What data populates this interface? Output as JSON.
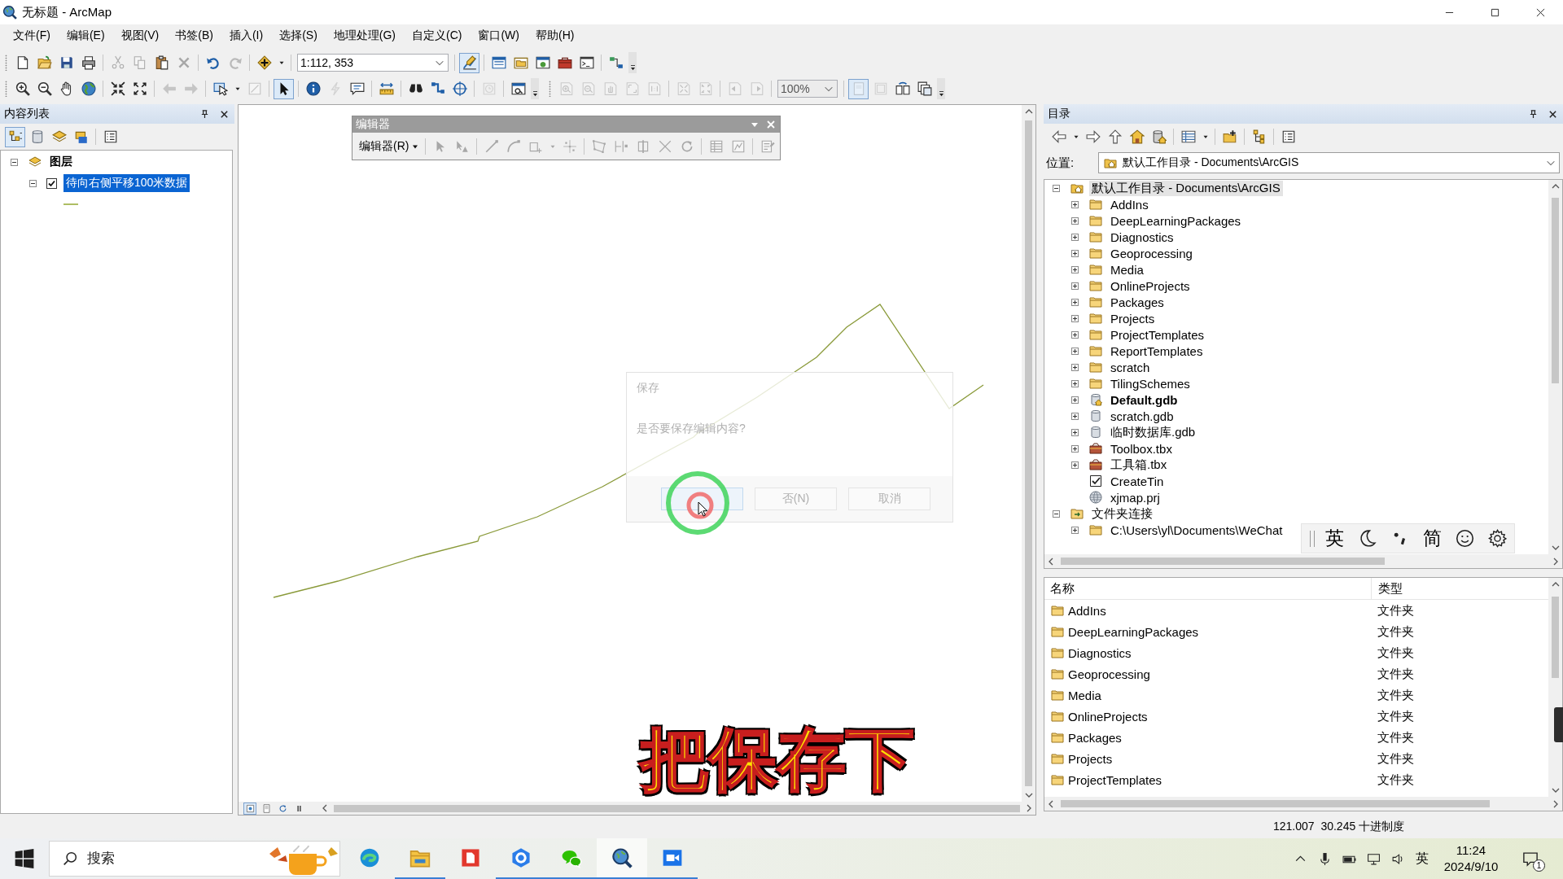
{
  "window": {
    "title": "无标题 - ArcMap"
  },
  "menu": [
    "文件(F)",
    "编辑(E)",
    "视图(V)",
    "书签(B)",
    "插入(I)",
    "选择(S)",
    "地理处理(G)",
    "自定义(C)",
    "窗口(W)",
    "帮助(H)"
  ],
  "toolbar_rows": [
    {
      "toolbars": [
        {
          "groups": [
            [
              {
                "kind": "new",
                "disabled": false,
                "pressed": false
              },
              {
                "kind": "open",
                "disabled": false,
                "pressed": false
              },
              {
                "kind": "save",
                "disabled": false,
                "pressed": false
              },
              {
                "kind": "print",
                "disabled": false,
                "pressed": false
              }
            ],
            [
              {
                "kind": "cut",
                "disabled": true,
                "pressed": false
              },
              {
                "kind": "copy",
                "disabled": true,
                "pressed": false
              },
              {
                "kind": "paste",
                "disabled": false,
                "pressed": false
              },
              {
                "kind": "delete",
                "disabled": true,
                "pressed": false
              }
            ],
            [
              {
                "kind": "undo",
                "disabled": false,
                "pressed": false
              },
              {
                "kind": "redo",
                "disabled": true,
                "pressed": false
              }
            ],
            [
              {
                "kind": "add-data",
                "disabled": false,
                "pressed": false
              },
              {
                "kind": "caret",
                "disabled": false,
                "pressed": false
              }
            ],
            [
              {
                "kind": "scale-combo",
                "value": "1:112, 353",
                "disabled": false,
                "pressed": false
              }
            ],
            [
              {
                "kind": "editor-toolbar",
                "disabled": false,
                "pressed": true
              }
            ],
            [
              {
                "kind": "toc-window",
                "disabled": false,
                "pressed": false
              },
              {
                "kind": "catalog-window",
                "disabled": false,
                "pressed": false
              },
              {
                "kind": "search-window",
                "disabled": false,
                "pressed": false
              },
              {
                "kind": "arctoolbox",
                "disabled": false,
                "pressed": false
              },
              {
                "kind": "python",
                "disabled": false,
                "pressed": false
              }
            ],
            [
              {
                "kind": "model-builder",
                "disabled": false,
                "pressed": false
              }
            ]
          ]
        }
      ]
    },
    {
      "toolbars": [
        {
          "groups": [
            [
              {
                "kind": "zoom-in",
                "disabled": false,
                "pressed": false
              },
              {
                "kind": "zoom-out",
                "disabled": false,
                "pressed": false
              },
              {
                "kind": "pan",
                "disabled": false,
                "pressed": false
              },
              {
                "kind": "full-extent",
                "disabled": false,
                "pressed": false
              }
            ],
            [
              {
                "kind": "fixed-zoom-in",
                "disabled": false,
                "pressed": false
              },
              {
                "kind": "fixed-zoom-out",
                "disabled": false,
                "pressed": false
              }
            ],
            [
              {
                "kind": "back",
                "disabled": true,
                "pressed": false
              },
              {
                "kind": "forward",
                "disabled": true,
                "pressed": false
              }
            ],
            [
              {
                "kind": "select-features",
                "disabled": false,
                "pressed": false
              },
              {
                "kind": "caret",
                "disabled": false,
                "pressed": false
              },
              {
                "kind": "clear-selection",
                "disabled": true,
                "pressed": false
              }
            ],
            [
              {
                "kind": "select-elements",
                "disabled": false,
                "pressed": true
              }
            ],
            [
              {
                "kind": "identify",
                "disabled": false,
                "pressed": false
              },
              {
                "kind": "hyperlink",
                "disabled": true,
                "pressed": false
              },
              {
                "kind": "html-popup",
                "disabled": false,
                "pressed": false
              }
            ],
            [
              {
                "kind": "measure",
                "disabled": false,
                "pressed": false
              }
            ],
            [
              {
                "kind": "find",
                "disabled": false,
                "pressed": false
              },
              {
                "kind": "find-route",
                "disabled": false,
                "pressed": false
              },
              {
                "kind": "go-to-xy",
                "disabled": false,
                "pressed": false
              }
            ],
            [
              {
                "kind": "time-slider",
                "disabled": true,
                "pressed": false
              }
            ],
            [
              {
                "kind": "viewer-window",
                "disabled": false,
                "pressed": false
              }
            ]
          ]
        },
        {
          "groups": [
            [
              {
                "kind": "page-zoom-in",
                "disabled": true,
                "pressed": false
              },
              {
                "kind": "page-zoom-out",
                "disabled": true,
                "pressed": false
              },
              {
                "kind": "page-pan",
                "disabled": true,
                "pressed": false
              },
              {
                "kind": "page-full",
                "disabled": true,
                "pressed": false
              },
              {
                "kind": "page-actual",
                "disabled": true,
                "pressed": false
              }
            ],
            [
              {
                "kind": "page-fixed-in",
                "disabled": true,
                "pressed": false
              },
              {
                "kind": "page-fixed-out",
                "disabled": true,
                "pressed": false
              }
            ],
            [
              {
                "kind": "page-back",
                "disabled": true,
                "pressed": false
              },
              {
                "kind": "page-forward",
                "disabled": true,
                "pressed": false
              }
            ],
            [
              {
                "kind": "zoom-combo",
                "value": "100%",
                "disabled": true,
                "pressed": false
              }
            ],
            [
              {
                "kind": "toggle-draft",
                "disabled": true,
                "pressed": true
              },
              {
                "kind": "focus-frame",
                "disabled": true,
                "pressed": false
              },
              {
                "kind": "change-layout",
                "disabled": false,
                "pressed": false
              },
              {
                "kind": "driven-pages",
                "disabled": false,
                "pressed": false
              }
            ]
          ]
        }
      ]
    }
  ],
  "table_of_contents": {
    "title": "内容列表",
    "toolbar": {
      "groups": [
        [
          {
            "kind": "list-drawing-order",
            "disabled": false,
            "pressed": true
          },
          {
            "kind": "list-source",
            "disabled": false,
            "pressed": false
          },
          {
            "kind": "list-visibility",
            "disabled": false,
            "pressed": false
          },
          {
            "kind": "list-selection",
            "disabled": false,
            "pressed": false
          }
        ],
        [
          {
            "kind": "options",
            "disabled": false,
            "pressed": false
          }
        ]
      ]
    },
    "tree": [
      {
        "label": "图层",
        "kind": "data-frame",
        "expanded": true,
        "selected": false,
        "children": [
          {
            "label": "待向右侧平移100米数据",
            "kind": "layer",
            "expanded": true,
            "checked": true,
            "selected": true
          }
        ]
      }
    ]
  },
  "map": {
    "editor_toolbar": {
      "title": "编辑器",
      "menu_label": "编辑器(R)",
      "groups": [
        [
          {
            "kind": "edit-tool",
            "disabled": true,
            "pressed": false
          },
          {
            "kind": "annotation-tool",
            "disabled": true,
            "pressed": false
          }
        ],
        [
          {
            "kind": "straight-segment",
            "disabled": true,
            "pressed": false
          },
          {
            "kind": "end-arc",
            "disabled": true,
            "pressed": false
          },
          {
            "kind": "trace",
            "disabled": true,
            "pressed": false
          },
          {
            "kind": "caret",
            "disabled": true,
            "pressed": false
          },
          {
            "kind": "midpoint",
            "disabled": true,
            "pressed": false
          }
        ],
        [
          {
            "kind": "edit-vertices",
            "disabled": true,
            "pressed": false
          },
          {
            "kind": "reshape",
            "disabled": true,
            "pressed": false
          },
          {
            "kind": "cut-polygons",
            "disabled": true,
            "pressed": false
          },
          {
            "kind": "split",
            "disabled": true,
            "pressed": false
          },
          {
            "kind": "rotate",
            "disabled": true,
            "pressed": false
          }
        ],
        [
          {
            "kind": "attributes",
            "disabled": true,
            "pressed": false
          },
          {
            "kind": "sketch-properties",
            "disabled": true,
            "pressed": false
          }
        ],
        [
          {
            "kind": "create-features",
            "disabled": true,
            "pressed": false
          }
        ]
      ]
    },
    "dialog": {
      "title": "保存",
      "message": "是否要保存编辑内容?",
      "buttons": [
        {
          "focused": true
        },
        {
          "label": "否(N)",
          "focused": false
        },
        {
          "label": "取消",
          "focused": false
        }
      ]
    },
    "view_buttons": [
      {
        "kind": "data-view",
        "pressed": true
      },
      {
        "kind": "layout-view",
        "pressed": false
      },
      {
        "kind": "refresh",
        "pressed": false
      },
      {
        "kind": "pause",
        "pressed": false
      }
    ]
  },
  "catalog": {
    "title": "目录",
    "toolbar": {
      "groups": [
        [
          {
            "kind": "back-nav",
            "disabled": false,
            "pressed": false
          },
          {
            "kind": "caret",
            "disabled": false,
            "pressed": false
          },
          {
            "kind": "forward-nav",
            "disabled": false,
            "pressed": false
          },
          {
            "kind": "up-level",
            "disabled": false,
            "pressed": false
          },
          {
            "kind": "home",
            "disabled": false,
            "pressed": false
          },
          {
            "kind": "home-database",
            "disabled": false,
            "pressed": false
          }
        ],
        [
          {
            "kind": "view-grid",
            "disabled": false,
            "pressed": false
          },
          {
            "kind": "caret",
            "disabled": false,
            "pressed": false
          }
        ],
        [
          {
            "kind": "connect-folder",
            "disabled": false,
            "pressed": false
          }
        ],
        [
          {
            "kind": "toggle-tree",
            "disabled": false,
            "pressed": false
          }
        ],
        [
          {
            "kind": "options",
            "disabled": false,
            "pressed": false
          }
        ]
      ]
    },
    "location_label": "位置:",
    "location": "默认工作目录 - Documents\\ArcGIS",
    "tree": [
      {
        "label": "默认工作目录 - Documents\\ArcGIS",
        "kind": "home-folder",
        "expanded": true,
        "selected": true,
        "children": [
          {
            "label": "AddIns",
            "kind": "folder",
            "expanded": false,
            "selected": false
          },
          {
            "label": "DeepLearningPackages",
            "kind": "folder",
            "expanded": false,
            "selected": false
          },
          {
            "label": "Diagnostics",
            "kind": "folder",
            "expanded": false,
            "selected": false
          },
          {
            "label": "Geoprocessing",
            "kind": "folder",
            "expanded": false,
            "selected": false
          },
          {
            "label": "Media",
            "kind": "folder",
            "expanded": false,
            "selected": false
          },
          {
            "label": "OnlineProjects",
            "kind": "folder",
            "expanded": false,
            "selected": false
          },
          {
            "label": "Packages",
            "kind": "folder",
            "expanded": false,
            "selected": false
          },
          {
            "label": "Projects",
            "kind": "folder",
            "expanded": false,
            "selected": false
          },
          {
            "label": "ProjectTemplates",
            "kind": "folder",
            "expanded": false,
            "selected": false
          },
          {
            "label": "ReportTemplates",
            "kind": "folder",
            "expanded": false,
            "selected": false
          },
          {
            "label": "scratch",
            "kind": "folder",
            "expanded": false,
            "selected": false
          },
          {
            "label": "TilingSchemes",
            "kind": "folder",
            "expanded": false,
            "selected": false
          },
          {
            "label": "Default.gdb",
            "kind": "default-gdb",
            "expanded": false,
            "selected": false
          },
          {
            "label": "scratch.gdb",
            "kind": "gdb",
            "expanded": false,
            "selected": false
          },
          {
            "label": "临时数据库.gdb",
            "kind": "gdb",
            "expanded": false,
            "selected": false
          },
          {
            "label": "Toolbox.tbx",
            "kind": "toolbox",
            "expanded": false,
            "selected": false
          },
          {
            "label": "工具箱.tbx",
            "kind": "toolbox",
            "expanded": false,
            "selected": false
          },
          {
            "label": "CreateTin",
            "kind": "tool",
            "selected": false
          },
          {
            "label": "xjmap.prj",
            "kind": "projection",
            "selected": false
          }
        ]
      },
      {
        "label": "文件夹连接",
        "kind": "folder-connection",
        "expanded": true,
        "selected": false,
        "children": [
          {
            "label": "C:\\Users\\yl\\Documents\\WeChat",
            "kind": "folder",
            "expanded": false,
            "selected": false
          }
        ]
      }
    ],
    "columns": [
      "名称",
      "类型"
    ],
    "rows": [
      {
        "name": "AddIns",
        "type": "文件夹"
      },
      {
        "name": "DeepLearningPackages",
        "type": "文件夹"
      },
      {
        "name": "Diagnostics",
        "type": "文件夹"
      },
      {
        "name": "Geoprocessing",
        "type": "文件夹"
      },
      {
        "name": "Media",
        "type": "文件夹"
      },
      {
        "name": "OnlineProjects",
        "type": "文件夹"
      },
      {
        "name": "Packages",
        "type": "文件夹"
      },
      {
        "name": "Projects",
        "type": "文件夹"
      },
      {
        "name": "ProjectTemplates",
        "type": "文件夹"
      }
    ]
  },
  "ime_toolbar": {
    "language": "英",
    "script": "简"
  },
  "subtitle": "把保存下",
  "status_bar": {
    "coordinates": "121.007  30.245 十进制度"
  },
  "taskbar": {
    "search_placeholder": "搜索",
    "apps": [
      {
        "kind": "edge",
        "running": false,
        "selected": false
      },
      {
        "kind": "explorer",
        "running": true,
        "selected": false
      },
      {
        "kind": "wps",
        "running": false,
        "selected": false
      },
      {
        "kind": "hex-app",
        "running": true,
        "selected": false
      },
      {
        "kind": "wechat",
        "running": true,
        "selected": false
      },
      {
        "kind": "arcmap",
        "running": true,
        "selected": true
      },
      {
        "kind": "meeting",
        "running": true,
        "selected": false
      }
    ],
    "input_language": "英",
    "time": "11:24",
    "date": "2024/9/10",
    "notification_count": "1"
  }
}
